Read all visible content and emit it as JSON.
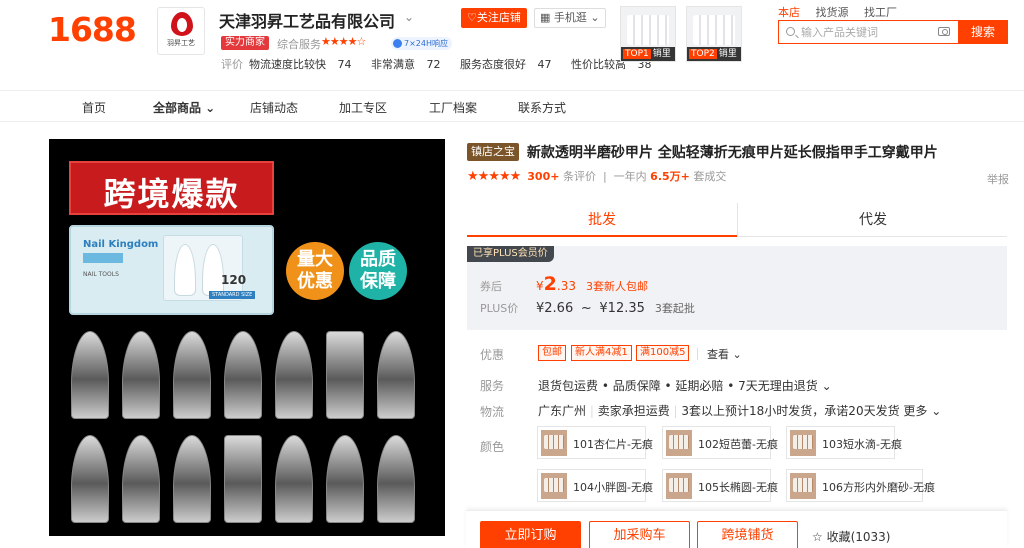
{
  "header": {
    "logo_text": "1688",
    "shop_brand": "羽昇工艺",
    "shop_name": "天津羽昇工艺品有限公司",
    "shop_chevron": "⌄",
    "follow_label": "♡关注店铺",
    "mobile_label": "▦ 手机逛 ⌄",
    "strength_badge": "实力商家",
    "score_label": "综合服务",
    "score_stars": "★★★★☆",
    "response_tag": "7×24H响应",
    "eval_label": "评价",
    "evaluations": [
      {
        "label": "物流速度比较快",
        "value": "74"
      },
      {
        "label": "非常满意",
        "value": "72"
      },
      {
        "label": "服务态度很好",
        "value": "47"
      },
      {
        "label": "性价比较高",
        "value": "38"
      }
    ],
    "top_items": [
      {
        "rank": "TOP1",
        "label": "销里"
      },
      {
        "rank": "TOP2",
        "label": "销里"
      }
    ],
    "search_tabs": [
      "本店",
      "找货源",
      "找工厂"
    ],
    "search_placeholder": "输入产品关键词",
    "search_button": "搜索"
  },
  "navbar": {
    "items": [
      "首页",
      "全部商品 ⌄",
      "店铺动态",
      "加工专区",
      "工厂档案",
      "联系方式"
    ]
  },
  "image": {
    "banner_text": "跨境爆款",
    "box_brand": "Nail Kingdom",
    "box_tools": "NAIL TOOLS",
    "box_count": "120",
    "box_std": "STANDARD SIZE",
    "circle1": "量大\n优惠",
    "circle2": "品质\n保障"
  },
  "product": {
    "shop_badge": "镇店之宝",
    "title": "新款透明半磨砂甲片 全贴轻薄折无痕甲片延长假指甲手工穿戴甲片",
    "stars": "★★★★★",
    "review_count": "300+",
    "review_suffix": "条评价",
    "sales_prefix": "一年内",
    "sales_count": "6.5万+",
    "sales_suffix": "套成交",
    "report": "举报"
  },
  "tabs": {
    "wholesale": "批发",
    "dropship": "代发"
  },
  "price": {
    "plus_tag": "已享PLUS会员价",
    "coupon_label": "券后",
    "currency": "¥",
    "coupon_int": "2",
    "coupon_dec": ".33",
    "coupon_note": "3套新人包邮",
    "plus_label": "PLUS价",
    "plus_low": "¥2.66",
    "plus_tilde": "~",
    "plus_high": "¥12.35",
    "plus_note": "3套起批"
  },
  "attrs": {
    "promo_label": "优惠",
    "promo_tags": [
      "包邮",
      "新人满4减1",
      "满100减5"
    ],
    "see_more": "查看 ⌄",
    "service_label": "服务",
    "service_text": "退货包运费 • 品质保障 • 延期必赔 • 7天无理由退货 ⌄",
    "logistics_label": "物流",
    "logistics_from": "广东广州",
    "logistics_freight": "卖家承担运费",
    "logistics_text": "3套以上预计18小时发货，承诺20天发货",
    "logistics_more": "更多 ⌄",
    "color_label": "颜色",
    "colors": [
      "101杏仁片-无痕",
      "102短芭蕾-无痕",
      "103短水滴-无痕",
      "104小胖圆-无痕",
      "105长椭圆-无痕",
      "106方形内外磨砂-无痕"
    ]
  },
  "buybar": {
    "order": "立即订购",
    "cart": "加采购车",
    "cross": "跨境铺货",
    "fav": "☆ 收藏(1033)"
  }
}
